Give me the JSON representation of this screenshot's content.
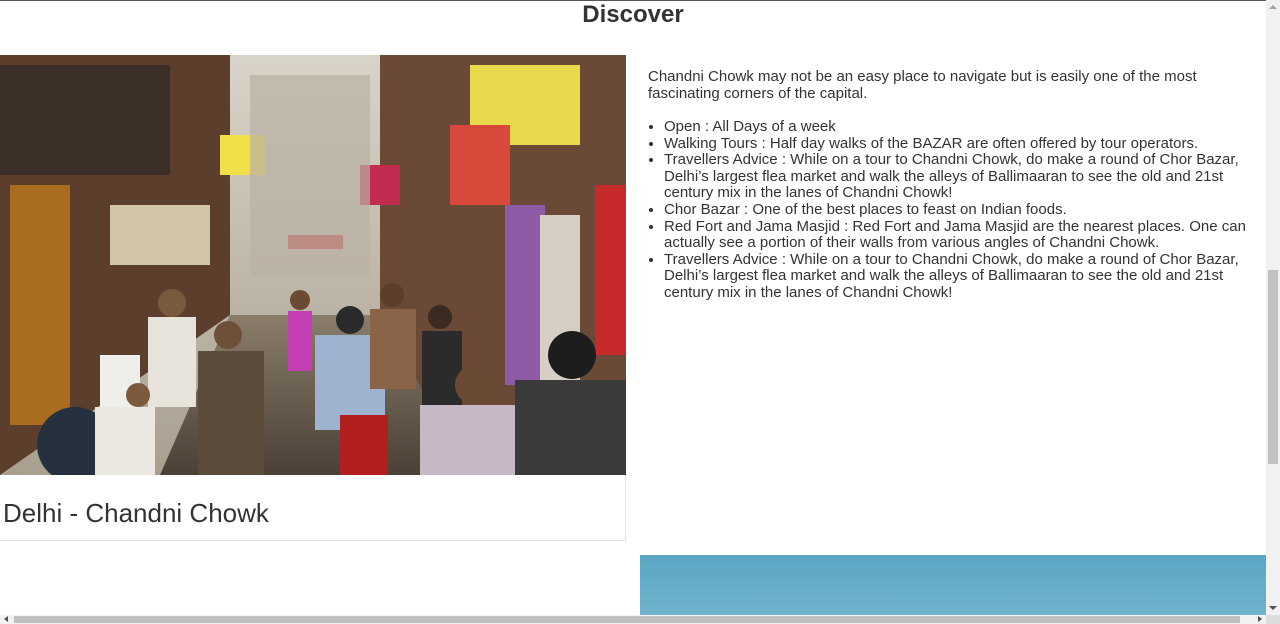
{
  "page": {
    "title": "Discover"
  },
  "card": {
    "caption": "Delhi - Chandni Chowk",
    "image_subject": "crowded market street with shop signs and people"
  },
  "details": {
    "intro": "Chandni Chowk may not be an easy place to navigate but is easily one of the most fascinating corners of the capital.",
    "items": [
      {
        "text": "Open : All Days of a week"
      },
      {
        "text": "Walking Tours : Half day walks of the BAZAR are often offered by tour operators."
      },
      {
        "text": "Travellers Advice : While on a tour to Chandni Chowk, do make a round of Chor Bazar, Delhi’s largest flea market and walk the alleys of Ballimaaran to see the old and 21st century mix in the lanes of Chandni Chowk!"
      },
      {
        "text": "Chor Bazar : One of the best places to feast on Indian foods."
      },
      {
        "text": "Red Fort and Jama Masjid : Red Fort and Jama Masjid are the nearest places. One can actually see a portion of their walls from various angles of Chandni Chowk."
      },
      {
        "text": "Travellers Advice : While on a tour to Chandni Chowk, do make a round of Chor Bazar, Delhi’s largest flea market and walk the alleys of Ballimaaran to see the old and 21st century mix in the lanes of Chandni Chowk!"
      }
    ]
  },
  "colors": {
    "text": "#333333",
    "sky": "#5aa6c3",
    "scroll_track": "#f1f1f1",
    "scroll_thumb": "#c1c1c1"
  },
  "icons": [
    "scroll-up-arrow-icon",
    "scroll-down-arrow-icon",
    "scroll-left-arrow-icon",
    "scroll-right-arrow-icon"
  ]
}
